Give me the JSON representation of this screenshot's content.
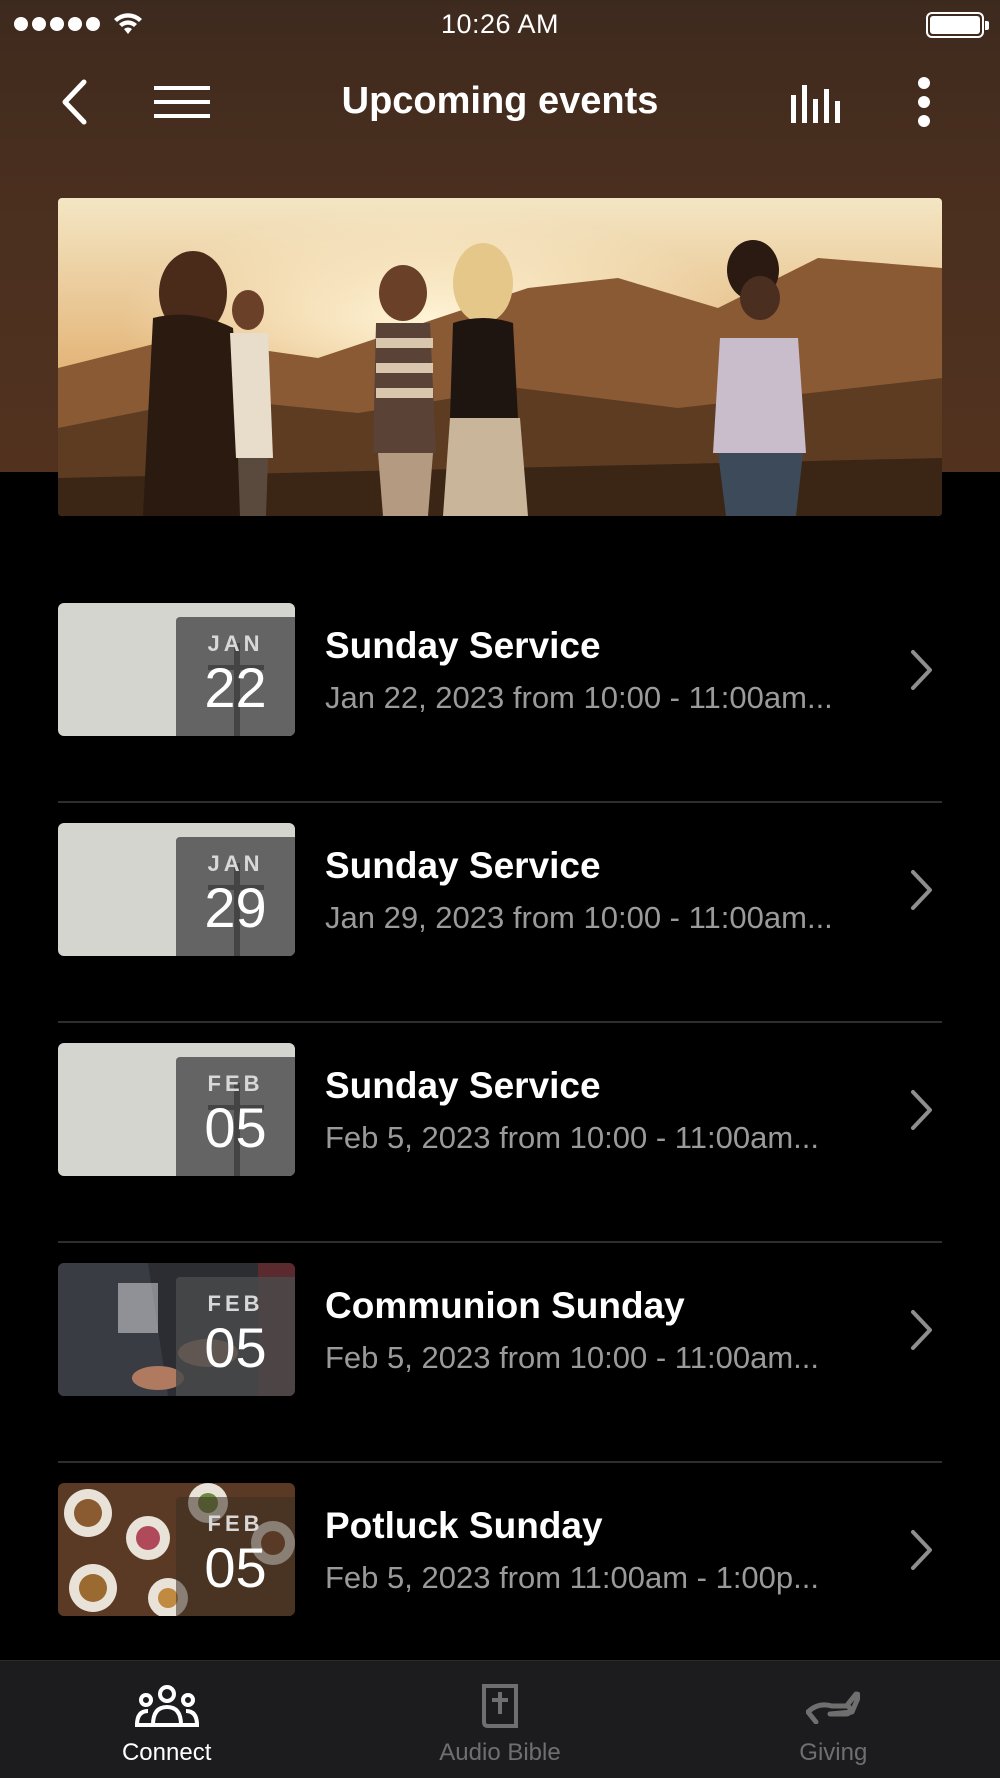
{
  "status_bar": {
    "time": "10:26 AM"
  },
  "header": {
    "title": "Upcoming events"
  },
  "events": [
    {
      "month": "JAN",
      "day": "22",
      "title": "Sunday Service",
      "subtitle": "Jan 22, 2023 from 10:00 - 11:00am...",
      "thumb": "cross"
    },
    {
      "month": "JAN",
      "day": "29",
      "title": "Sunday Service",
      "subtitle": "Jan 29, 2023 from 10:00 - 11:00am...",
      "thumb": "cross"
    },
    {
      "month": "FEB",
      "day": "05",
      "title": "Sunday Service",
      "subtitle": "Feb 5, 2023 from 10:00 - 11:00am...",
      "thumb": "cross"
    },
    {
      "month": "FEB",
      "day": "05",
      "title": "Communion Sunday",
      "subtitle": "Feb 5, 2023 from 10:00 - 11:00am...",
      "thumb": "communion"
    },
    {
      "month": "FEB",
      "day": "05",
      "title": "Potluck Sunday",
      "subtitle": "Feb 5, 2023 from 11:00am - 1:00p...",
      "thumb": "potluck"
    }
  ],
  "tabs": [
    {
      "label": "Connect",
      "icon": "people-icon",
      "active": true
    },
    {
      "label": "Audio Bible",
      "icon": "bible-icon",
      "active": false
    },
    {
      "label": "Giving",
      "icon": "giving-hand-icon",
      "active": false
    }
  ],
  "colors": {
    "header_bg": "#4a2f1f",
    "background": "#000000",
    "tabbar_bg": "#1c1c1e",
    "subtitle": "#9a9a9a"
  }
}
